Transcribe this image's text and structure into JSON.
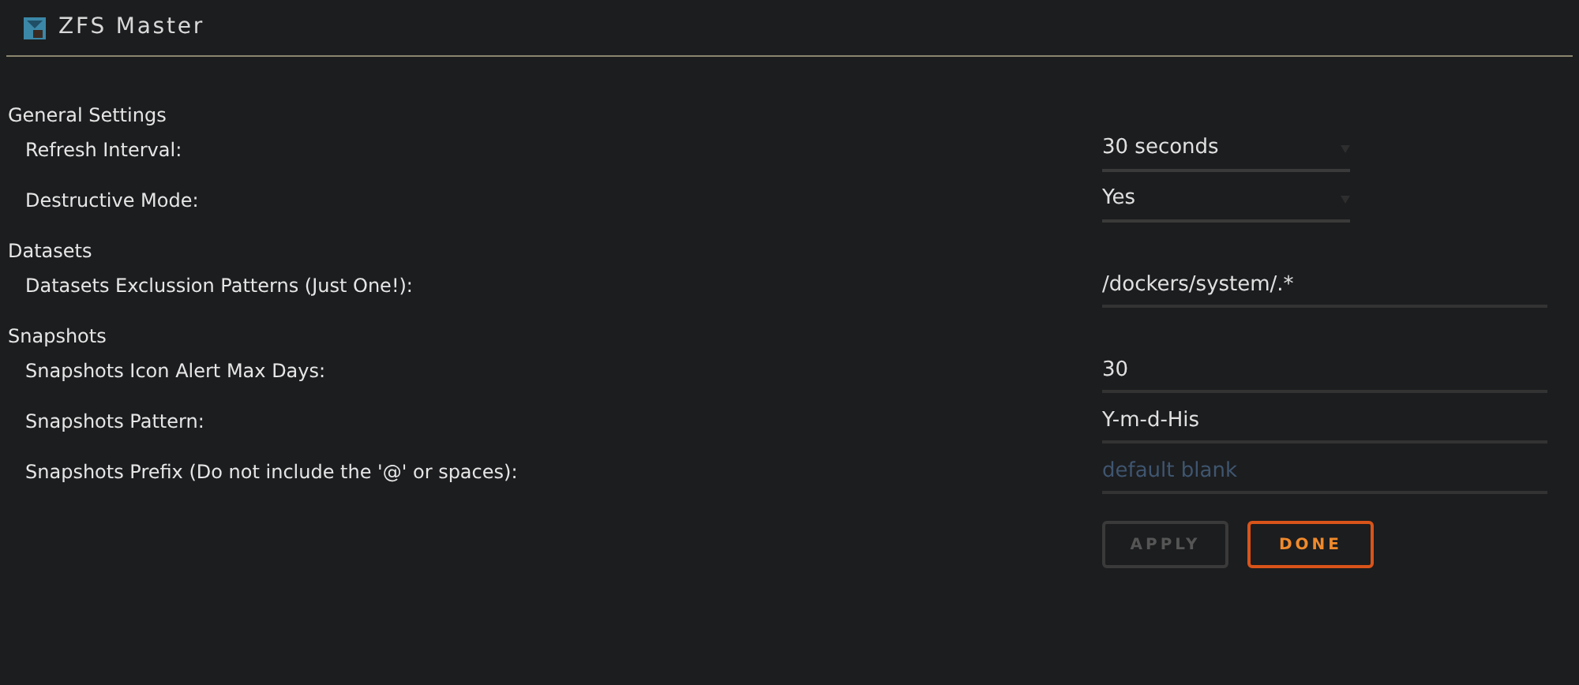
{
  "window": {
    "title": "ZFS Master"
  },
  "sections": [
    {
      "title": "General Settings",
      "rows": [
        {
          "label": "Refresh Interval:",
          "kind": "select",
          "value": "30 seconds"
        },
        {
          "label": "Destructive Mode:",
          "kind": "select",
          "value": "Yes"
        }
      ]
    },
    {
      "title": "Datasets",
      "rows": [
        {
          "label": "Datasets Exclussion Patterns (Just One!):",
          "kind": "input",
          "value": "/dockers/system/.*"
        }
      ]
    },
    {
      "title": "Snapshots",
      "rows": [
        {
          "label": "Snapshots Icon Alert Max Days:",
          "kind": "input",
          "value": "30"
        },
        {
          "label": "Snapshots Pattern:",
          "kind": "input",
          "value": "Y-m-d-His"
        },
        {
          "label": "Snapshots Prefix (Do not include the '@' or spaces):",
          "kind": "input",
          "placeholder": "default blank"
        }
      ]
    }
  ],
  "buttons": [
    {
      "label": "APPLY",
      "disabled": true
    },
    {
      "label": "DONE",
      "disabled": false
    }
  ]
}
